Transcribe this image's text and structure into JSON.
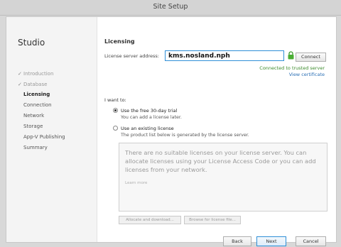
{
  "window": {
    "title": "Site Setup"
  },
  "sidebar": {
    "title": "Studio",
    "items": [
      {
        "label": "Introduction",
        "state": "done"
      },
      {
        "label": "Database",
        "state": "done"
      },
      {
        "label": "Licensing",
        "state": "active"
      },
      {
        "label": "Connection",
        "state": "pending"
      },
      {
        "label": "Network",
        "state": "pending"
      },
      {
        "label": "Storage",
        "state": "pending"
      },
      {
        "label": "App-V Publishing",
        "state": "pending"
      },
      {
        "label": "Summary",
        "state": "pending"
      }
    ]
  },
  "licensing": {
    "section_title": "Licensing",
    "server_label": "License server address:",
    "server_value": "kms.nosland.nph",
    "connect_label": "Connect",
    "status": "Connected to trusted server",
    "view_certificate": "View certificate",
    "want_label": "I want to:",
    "options": [
      {
        "label": "Use the free 30-day trial",
        "sub": "You can add a license later.",
        "selected": true
      },
      {
        "label": "Use an existing license",
        "sub": "The product list below is generated by the license server.",
        "selected": false
      }
    ],
    "empty_message": "There are no suitable licenses on your license server. You can allocate licenses using your License Access Code or you can add licenses from your network.",
    "learn_more": "Learn more",
    "allocate_label": "Allocate and download...",
    "browse_label": "Browse for license file..."
  },
  "footer": {
    "back": "Back",
    "next": "Next",
    "cancel": "Cancel"
  },
  "colors": {
    "accent": "#2f8fd7",
    "success": "#3a8a2a",
    "link": "#2a6fb5"
  },
  "icons": {
    "lock": "lock-icon",
    "check": "check-icon"
  }
}
